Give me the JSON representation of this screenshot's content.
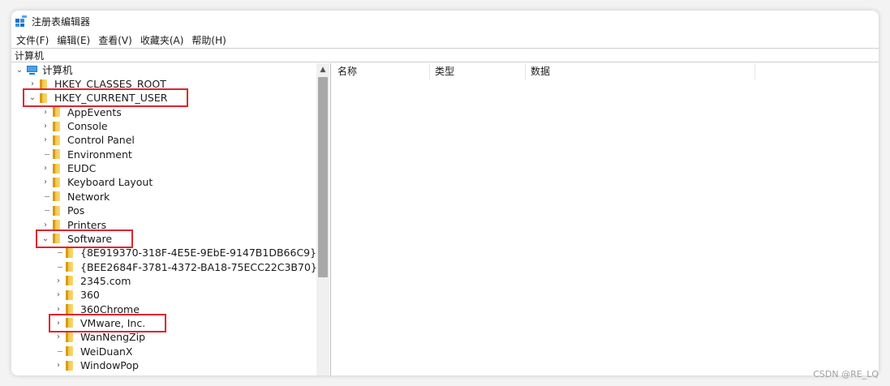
{
  "window": {
    "title": "注册表编辑器"
  },
  "menu": [
    {
      "key": "file",
      "label": "文件(F)"
    },
    {
      "key": "edit",
      "label": "编辑(E)"
    },
    {
      "key": "view",
      "label": "查看(V)"
    },
    {
      "key": "favorites",
      "label": "收藏夹(A)"
    },
    {
      "key": "help",
      "label": "帮助(H)"
    }
  ],
  "address": {
    "path": "计算机"
  },
  "tree": {
    "root": {
      "label": "计算机",
      "expanded": true
    },
    "items": [
      {
        "label": "HKEY_CLASSES_ROOT",
        "depth": 1,
        "expander": "collapsed"
      },
      {
        "label": "HKEY_CURRENT_USER",
        "depth": 1,
        "expander": "expanded",
        "highlighted": true
      },
      {
        "label": "AppEvents",
        "depth": 2,
        "expander": "collapsed"
      },
      {
        "label": "Console",
        "depth": 2,
        "expander": "collapsed"
      },
      {
        "label": "Control Panel",
        "depth": 2,
        "expander": "collapsed"
      },
      {
        "label": "Environment",
        "depth": 2,
        "expander": "none"
      },
      {
        "label": "EUDC",
        "depth": 2,
        "expander": "collapsed"
      },
      {
        "label": "Keyboard Layout",
        "depth": 2,
        "expander": "collapsed"
      },
      {
        "label": "Network",
        "depth": 2,
        "expander": "none"
      },
      {
        "label": "Pos",
        "depth": 2,
        "expander": "none"
      },
      {
        "label": "Printers",
        "depth": 2,
        "expander": "collapsed"
      },
      {
        "label": "Software",
        "depth": 2,
        "expander": "expanded",
        "highlighted": true
      },
      {
        "label": "{8E919370-318F-4E5E-9EbE-9147B1DB66C9}",
        "depth": 3,
        "expander": "none"
      },
      {
        "label": "{BEE2684F-3781-4372-BA18-75ECC22C3B70}",
        "depth": 3,
        "expander": "none"
      },
      {
        "label": "2345.com",
        "depth": 3,
        "expander": "collapsed"
      },
      {
        "label": "360",
        "depth": 3,
        "expander": "collapsed"
      },
      {
        "label": "360Chrome",
        "depth": 3,
        "expander": "collapsed"
      },
      {
        "label": "VMware, Inc.",
        "depth": 3,
        "expander": "collapsed",
        "highlighted": true
      },
      {
        "label": "WanNengZip",
        "depth": 3,
        "expander": "collapsed"
      },
      {
        "label": "WeiDuanX",
        "depth": 3,
        "expander": "none"
      },
      {
        "label": "WindowPop",
        "depth": 3,
        "expander": "collapsed"
      }
    ]
  },
  "list": {
    "columns": [
      {
        "label": "名称"
      },
      {
        "label": "类型"
      },
      {
        "label": "数据"
      }
    ]
  },
  "watermark": "CSDN @RE_LQ",
  "colors": {
    "highlight_box": "#e0242f",
    "folder": "#f2c84b"
  }
}
